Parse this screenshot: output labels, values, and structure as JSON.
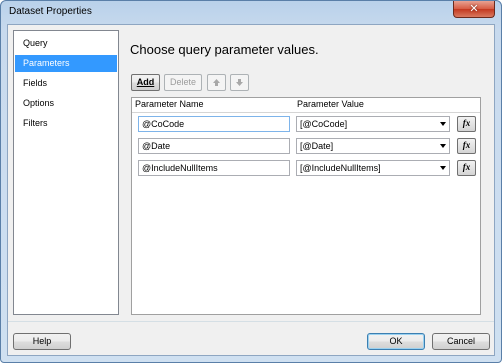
{
  "window": {
    "title": "Dataset Properties",
    "close_glyph": "✕"
  },
  "nav": {
    "items": [
      {
        "label": "Query"
      },
      {
        "label": "Parameters",
        "selected": true
      },
      {
        "label": "Fields"
      },
      {
        "label": "Options"
      },
      {
        "label": "Filters"
      }
    ]
  },
  "main": {
    "heading": "Choose query parameter values.",
    "toolbar": {
      "add_label": "Add",
      "delete_label": "Delete",
      "move_up_icon": "arrow-up-icon",
      "move_down_icon": "arrow-down-icon"
    },
    "grid": {
      "headers": {
        "name": "Parameter Name",
        "value": "Parameter Value"
      },
      "rows": [
        {
          "name": "@CoCode",
          "value": "[@CoCode]"
        },
        {
          "name": "@Date",
          "value": "[@Date]"
        },
        {
          "name": "@IncludeNullItems",
          "value": "[@IncludeNullItems]"
        }
      ],
      "expression_button_label": "fx"
    }
  },
  "footer": {
    "help_label": "Help",
    "ok_label": "OK",
    "cancel_label": "Cancel"
  }
}
